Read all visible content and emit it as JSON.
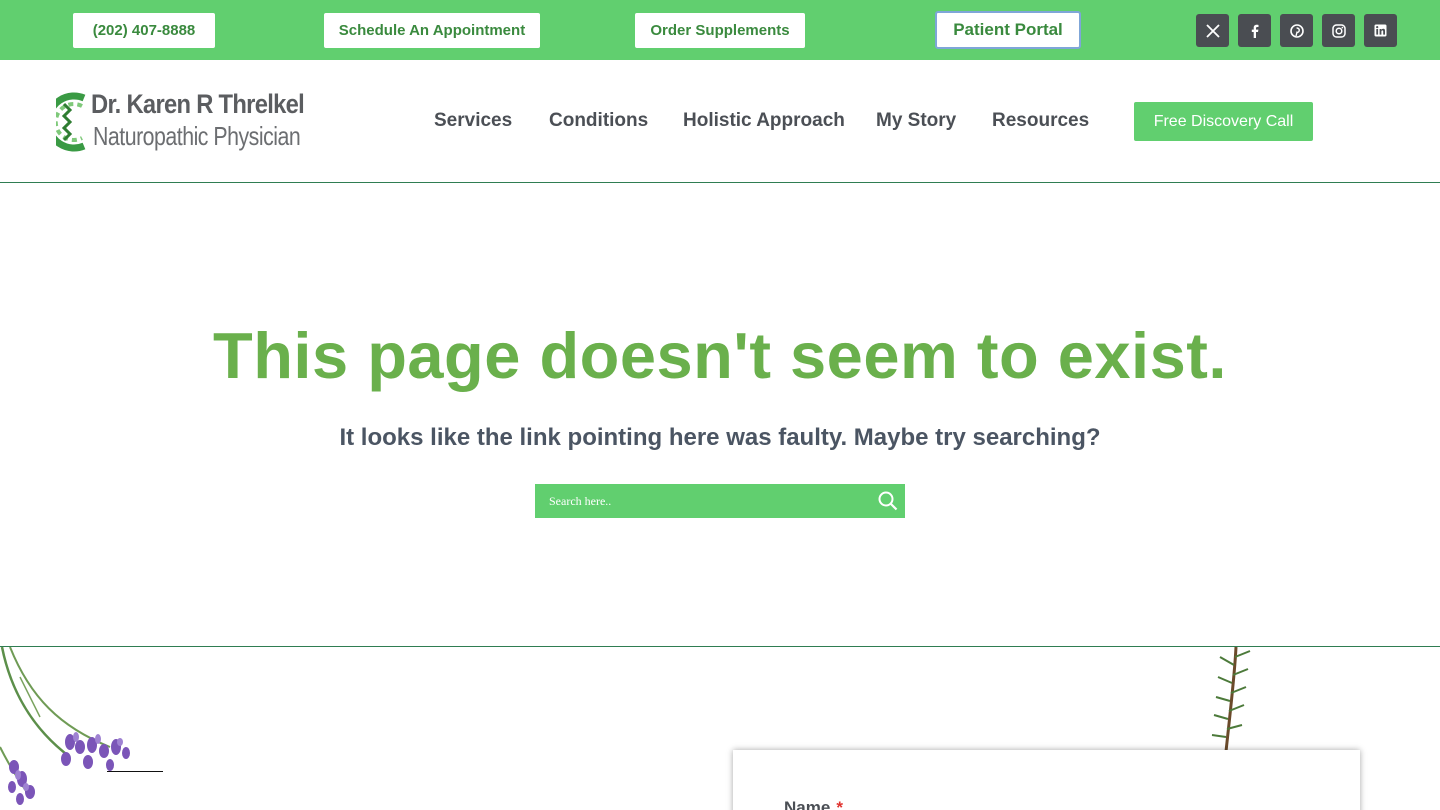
{
  "topbar": {
    "phone_label": "(202) 407-8888",
    "appointment_label": "Schedule An Appointment",
    "supplements_label": "Order Supplements",
    "portal_label": "Patient Portal",
    "social_icons": [
      "x-icon",
      "facebook-icon",
      "pinterest-icon",
      "instagram-icon",
      "linkedin-icon"
    ]
  },
  "header": {
    "logo_name": "Dr. Karen R Threlkel",
    "logo_subtitle": "Naturopathic Physician",
    "nav": [
      "Services",
      "Conditions",
      "Holistic Approach",
      "My Story",
      "Resources"
    ],
    "cta_label": "Free Discovery Call"
  },
  "main": {
    "headline": "This page doesn't seem to exist.",
    "subline": "It looks like the link pointing here was faulty. Maybe try searching?",
    "search_placeholder": "Search here.."
  },
  "form": {
    "name_label": "Name",
    "required_mark": "*"
  },
  "colors": {
    "brand_green": "#61cf6f",
    "headline_green": "#6ab04c",
    "nav_text": "#4b4f55",
    "social_bg": "#4a4d52"
  }
}
